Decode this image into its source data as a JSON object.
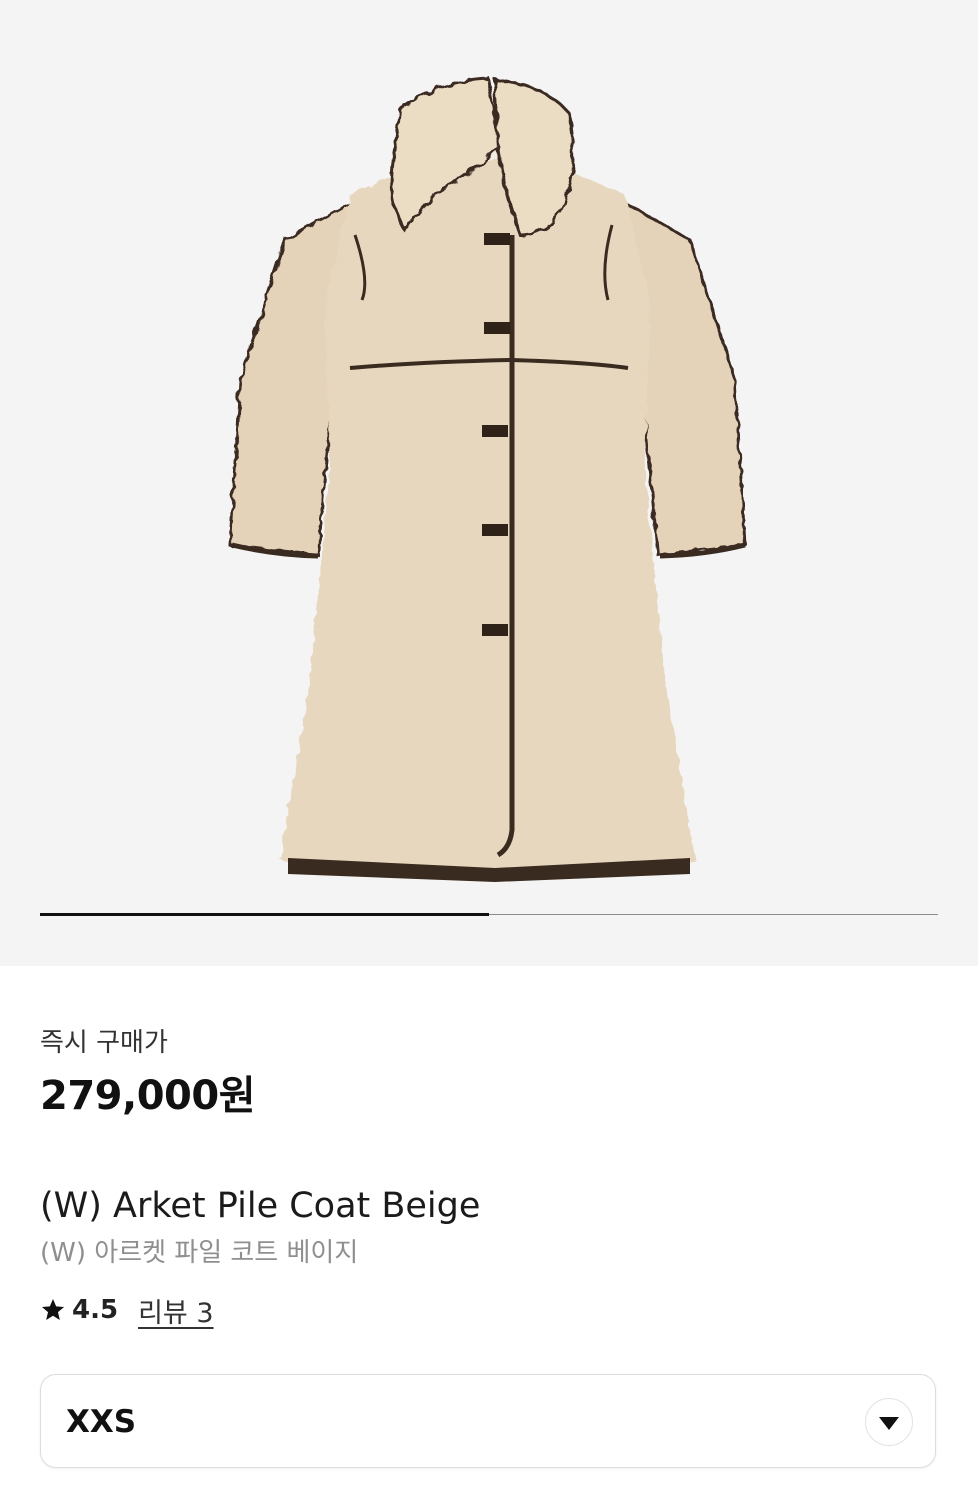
{
  "product_image": {
    "subject": "beige pile coat with dark brown piping and buckle fastenings",
    "gallery_progress": 0.5
  },
  "pricing": {
    "label": "즉시 구매가",
    "price": "279,000원"
  },
  "product": {
    "name_en": "(W) Arket Pile Coat Beige",
    "name_ko": "(W) 아르켓 파일 코트 베이지"
  },
  "rating": {
    "icon": "star-icon",
    "value": "4.5",
    "reviews_label": "리뷰 3"
  },
  "size_selector": {
    "selected": "XXS",
    "icon": "chevron-down-icon"
  },
  "colors": {
    "hero_bg": "#f4f4f4",
    "coat": "#e6d6bd",
    "piping": "#3a2b20",
    "text_primary": "#111111",
    "text_muted": "#8f8f8f"
  }
}
